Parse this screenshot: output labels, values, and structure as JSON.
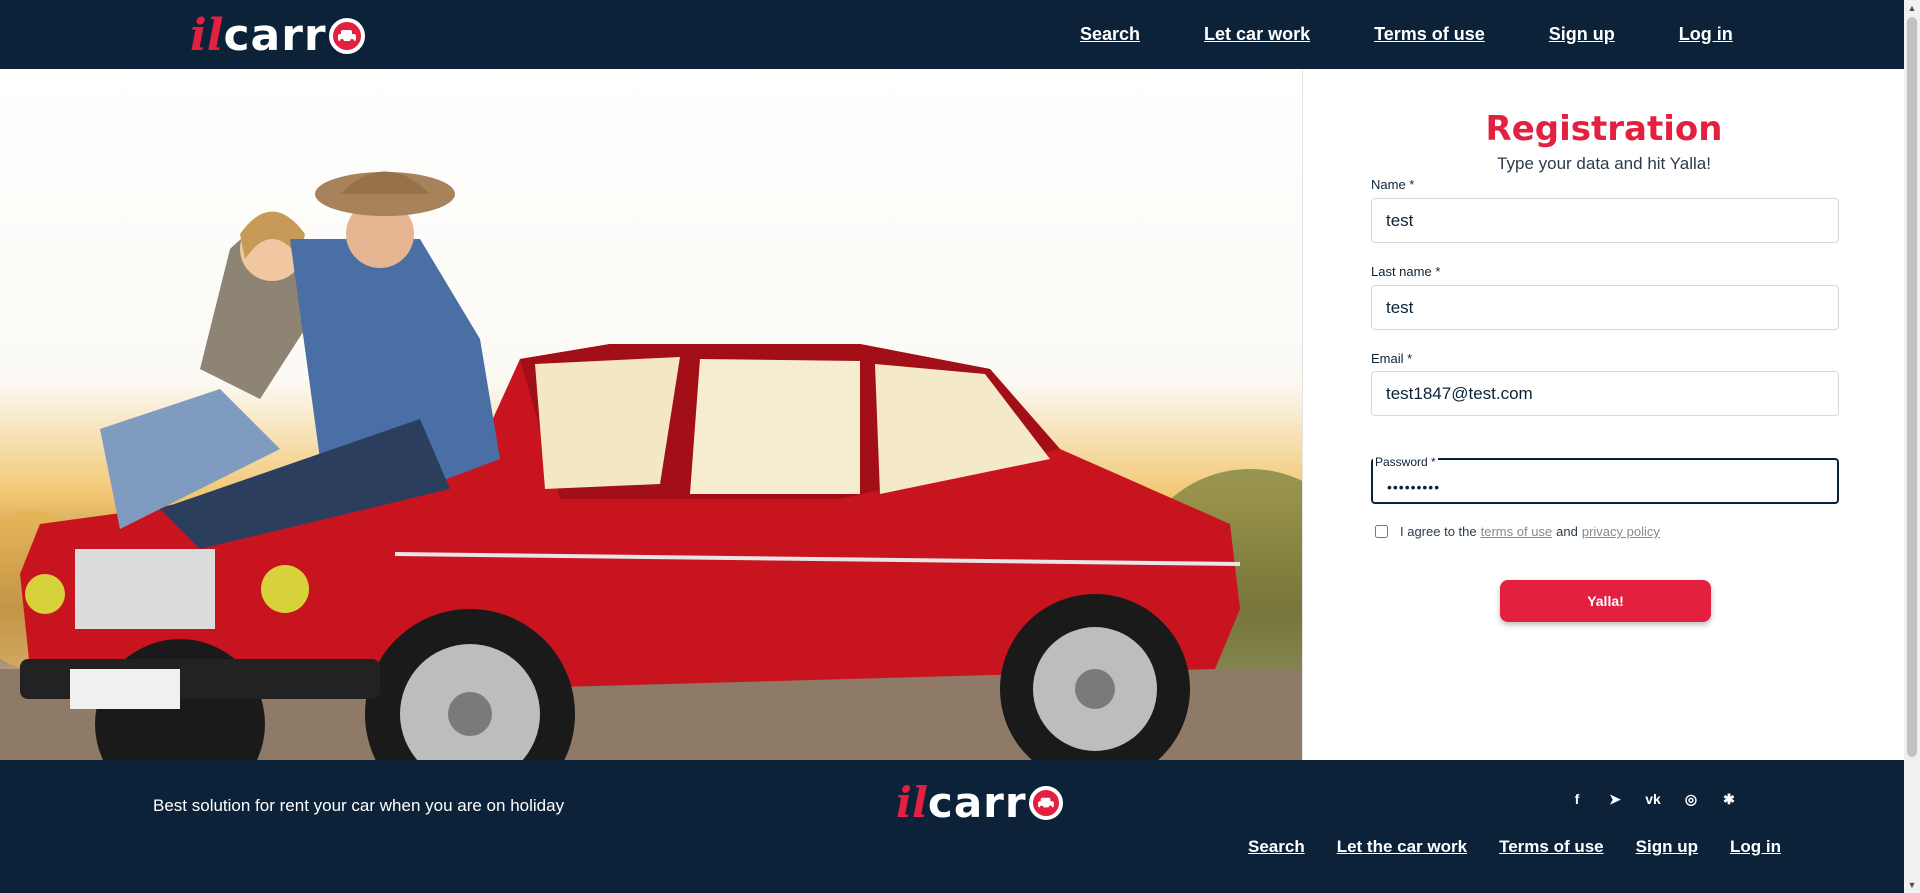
{
  "brand": {
    "logo_il": "il",
    "logo_carr": "carr",
    "accent": "#e3203f",
    "navy": "#0b2239"
  },
  "header": {
    "nav": [
      "Search",
      "Let car work",
      "Terms of use",
      "Sign up",
      "Log in"
    ]
  },
  "registration": {
    "title": "Registration",
    "subtitle": "Type your data and hit Yalla!",
    "name_label": "Name *",
    "name_value": "test",
    "last_name_label": "Last name *",
    "last_name_value": "test",
    "email_label": "Email *",
    "email_value": "test1847@test.com",
    "password_label": "Password *",
    "password_value": "•••••••••",
    "agree_prefix": "I agree to the",
    "terms_link": "terms of use",
    "agree_and": "and",
    "privacy_link": "privacy policy",
    "submit_label": "Yalla!"
  },
  "footer": {
    "tagline": "Best solution for rent your car when you are on holiday",
    "socials": [
      "facebook-icon",
      "telegram-icon",
      "vk-icon",
      "instagram-icon",
      "slack-icon"
    ],
    "social_glyphs": [
      "f",
      "➤",
      "vk",
      "◎",
      "✱"
    ],
    "nav": [
      "Search",
      "Let the car work",
      "Terms of use",
      "Sign up",
      "Log in"
    ]
  }
}
